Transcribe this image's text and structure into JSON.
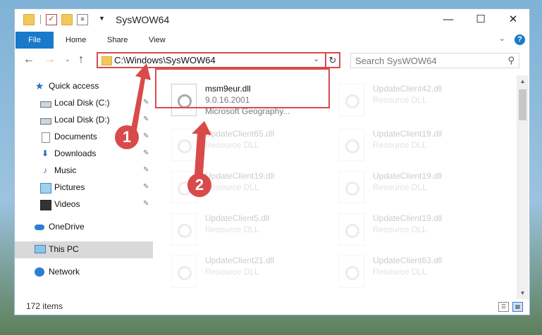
{
  "window": {
    "title": "SysWOW64",
    "quick_access_icons": [
      "folder-icon",
      "checkmark-icon",
      "folder-icon",
      "properties-icon"
    ],
    "controls": {
      "minimize": "—",
      "maximize": "☐",
      "close": "✕"
    }
  },
  "ribbon": {
    "tabs": [
      "File",
      "Home",
      "Share",
      "View"
    ],
    "expand_glyph": "⌄",
    "help_glyph": "?"
  },
  "nav": {
    "back": "←",
    "forward": "→",
    "recent": "⌄",
    "up": "↑",
    "address": "C:\\Windows\\SysWOW64",
    "address_chevron": "⌄",
    "refresh": "↻",
    "search_placeholder": "Search SysWOW64",
    "search_glyph": "⚲"
  },
  "sidebar": {
    "items": [
      {
        "label": "Quick access",
        "icon": "star-icon",
        "pinned": false
      },
      {
        "label": "Local Disk (C:)",
        "icon": "drive-icon",
        "pinned": true
      },
      {
        "label": "Local Disk (D:)",
        "icon": "drive-icon",
        "pinned": true
      },
      {
        "label": "Documents",
        "icon": "documents-icon",
        "pinned": true
      },
      {
        "label": "Downloads",
        "icon": "download-icon",
        "pinned": true
      },
      {
        "label": "Music",
        "icon": "music-icon",
        "pinned": true
      },
      {
        "label": "Pictures",
        "icon": "pictures-icon",
        "pinned": true
      },
      {
        "label": "Videos",
        "icon": "video-icon",
        "pinned": true
      },
      {
        "label": "OneDrive",
        "icon": "cloud-icon",
        "pinned": false
      },
      {
        "label": "This PC",
        "icon": "computer-icon",
        "pinned": false
      },
      {
        "label": "Network",
        "icon": "network-icon",
        "pinned": false
      }
    ],
    "pin_glyph": "✎"
  },
  "files": {
    "highlighted": {
      "name": "msm9eur.dll",
      "version": "9.0.16.2001",
      "description": "Microsoft Geography..."
    },
    "background": [
      {
        "name": "UpdateClient42.dll",
        "type": "Resource DLL"
      },
      {
        "name": "UpdateClient65.dll",
        "type": "Resource DLL"
      },
      {
        "name": "UpdateClient19.dll",
        "type": "Resource DLL"
      },
      {
        "name": "UpdateClient19.dll",
        "type": "Resource DLL"
      },
      {
        "name": "UpdateClient19.dll",
        "type": "Resource DLL"
      },
      {
        "name": "UpdateClient5.dll",
        "type": "Resource DLL"
      },
      {
        "name": "UpdateClient19.dll",
        "type": "Resource DLL"
      },
      {
        "name": "UpdateClient21.dll",
        "type": "Resource DLL"
      },
      {
        "name": "UpdateClient63.dll",
        "type": "Resource DLL"
      }
    ]
  },
  "scrollbar": {
    "up": "▲",
    "down": "▼"
  },
  "status": {
    "count": "172 items",
    "details_glyph": "☰",
    "tiles_glyph": "▦"
  },
  "markers": [
    "1",
    "2"
  ],
  "colors": {
    "accent": "#1979ca",
    "highlight": "#d94a4a",
    "selected_nav": "#d9d9d9"
  }
}
